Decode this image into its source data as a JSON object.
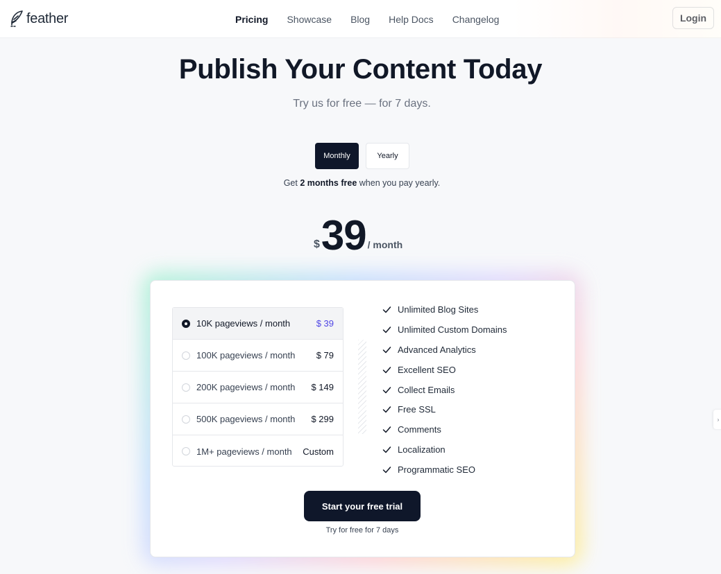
{
  "header": {
    "logo_text": "feather",
    "nav": [
      {
        "label": "Pricing",
        "active": true
      },
      {
        "label": "Showcase",
        "active": false
      },
      {
        "label": "Blog",
        "active": false
      },
      {
        "label": "Help Docs",
        "active": false
      },
      {
        "label": "Changelog",
        "active": false
      }
    ],
    "login_label": "Login"
  },
  "hero": {
    "title": "Publish Your Content Today",
    "subtitle": "Try us for free — for 7 days."
  },
  "billing_toggle": {
    "monthly_label": "Monthly",
    "yearly_label": "Yearly",
    "selected": "Monthly"
  },
  "promo": {
    "prefix": "Get ",
    "bold": "2 months free",
    "suffix": " when you pay yearly."
  },
  "price": {
    "currency": "$",
    "amount": "39",
    "period": "/ month"
  },
  "plans": [
    {
      "label": "10K pageviews / month",
      "price": "$ 39",
      "selected": true
    },
    {
      "label": "100K pageviews / month",
      "price": "$ 79",
      "selected": false
    },
    {
      "label": "200K pageviews / month",
      "price": "$ 149",
      "selected": false
    },
    {
      "label": "500K pageviews / month",
      "price": "$ 299",
      "selected": false
    },
    {
      "label": "1M+ pageviews / month",
      "price": "Custom",
      "selected": false
    }
  ],
  "features": [
    "Unlimited Blog Sites",
    "Unlimited Custom Domains",
    "Advanced Analytics",
    "Excellent SEO",
    "Collect Emails",
    "Free SSL",
    "Comments",
    "Localization",
    "Programmatic SEO"
  ],
  "cta": {
    "label": "Start your free trial",
    "sublabel": "Try for free for 7 days"
  },
  "colors": {
    "primary_dark": "#0f172a",
    "accent_selected_price": "#4f46e5"
  },
  "edge_widget_icon": "chat-icon"
}
